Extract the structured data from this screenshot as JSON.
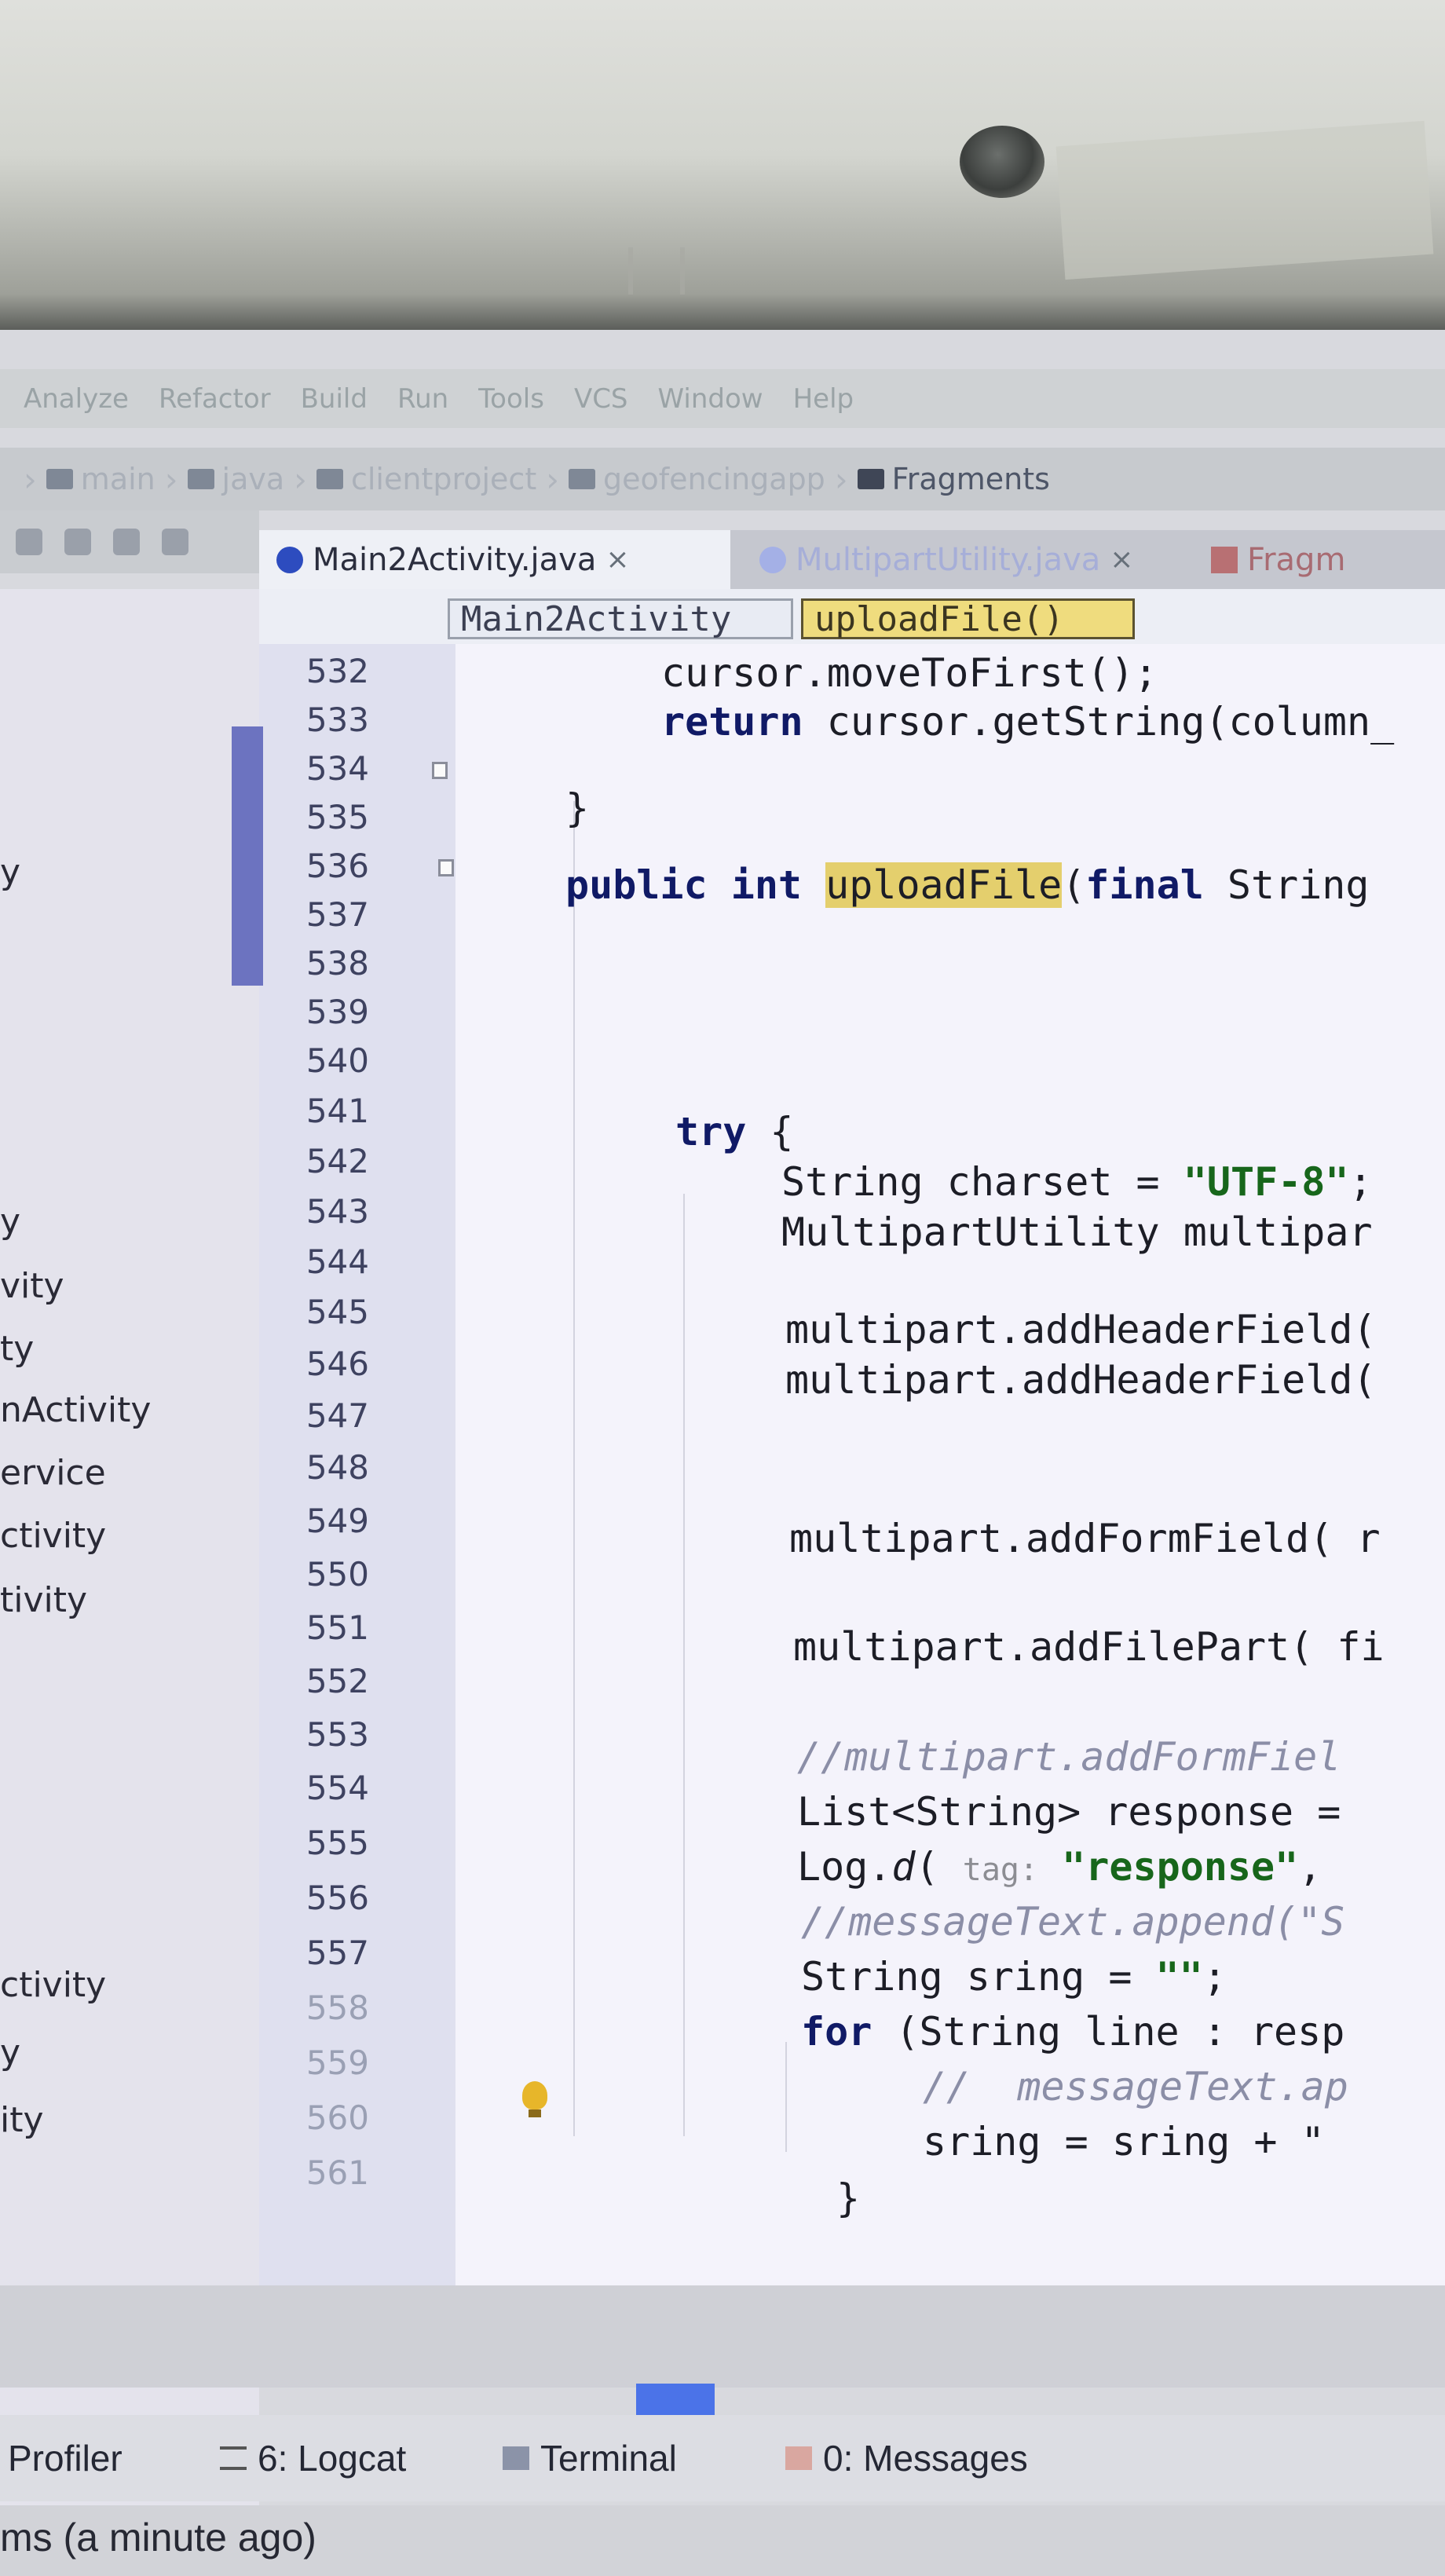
{
  "menu": [
    "Analyze",
    "Refactor",
    "Build",
    "Run",
    "Tools",
    "VCS",
    "Window",
    "Help"
  ],
  "breadcrumb": [
    "main",
    "java",
    "clientproject",
    "geofencingapp",
    "Fragments"
  ],
  "tabs": {
    "active": "Main2Activity.java",
    "second": "MultipartUtility.java",
    "third": "Fragm",
    "close": "×"
  },
  "editor_crumbs": {
    "class_name": "Main2Activity",
    "method_name": "uploadFile()"
  },
  "project_items": [
    "y",
    "y",
    "vity",
    "ty",
    "nActivity",
    "ervice",
    "ctivity",
    "tivity",
    "ctivity",
    "y",
    "ity"
  ],
  "line_numbers": [
    "532",
    "533",
    "534",
    "535",
    "536",
    "537",
    "538",
    "539",
    "540",
    "541",
    "542",
    "543",
    "544",
    "545",
    "546",
    "547",
    "548",
    "549",
    "550",
    "551",
    "552",
    "553",
    "554",
    "555",
    "556",
    "557",
    "558",
    "559",
    "560",
    "561"
  ],
  "code": {
    "l532": "cursor.moveToFirst();",
    "l533_kw": "return",
    "l533_rest": " cursor.getString(column_",
    "l534": "}",
    "l536_kw1": "public int",
    "l536_fn": "uploadFile",
    "l536_rest": "(",
    "l536_kw2": "final",
    "l536_tail": " String",
    "l541_kw": "try",
    "l541_rest": " {",
    "l542_a": "String charset = ",
    "l542_str": "\"UTF-8\"",
    "l542_b": ";",
    "l543": "MultipartUtility multipar",
    "l544": "multipart.addHeaderField(",
    "l545": "multipart.addHeaderField(",
    "l548": "multipart.addFormField( r",
    "l550": "multipart.addFilePart( fi",
    "l552": "//multipart.addFormFiel",
    "l553": "List<String> response =",
    "l554_a": "Log.",
    "l554_d": "d",
    "l554_b": "( ",
    "l554_hint": "tag:",
    "l554_str": " \"response\"",
    "l554_c": ",",
    "l555": "//messageText.append(\"S",
    "l556_a": "String sring = ",
    "l556_str": "\"\"",
    "l556_b": ";",
    "l557_kw": "for",
    "l557_rest": " (String line : resp",
    "l558": "//  messageText.ap",
    "l559": "sring = sring + \"",
    "l560": "}"
  },
  "tool_windows": {
    "profiler": "Profiler",
    "logcat": "6: Logcat",
    "terminal": "Terminal",
    "messages": "0: Messages"
  },
  "status": "ms (a minute ago)",
  "colors": {
    "keyword": "#101a66",
    "string": "#17661b",
    "comment": "#8b8ea7",
    "method_highlight": "#e4cf6d",
    "active_tab_icon": "#2d4cbf"
  },
  "icons": [
    "camera-icon",
    "folder-icon",
    "java-class-icon",
    "fold-marker-icon",
    "lightbulb-icon",
    "logcat-icon",
    "terminal-icon",
    "messages-icon"
  ]
}
